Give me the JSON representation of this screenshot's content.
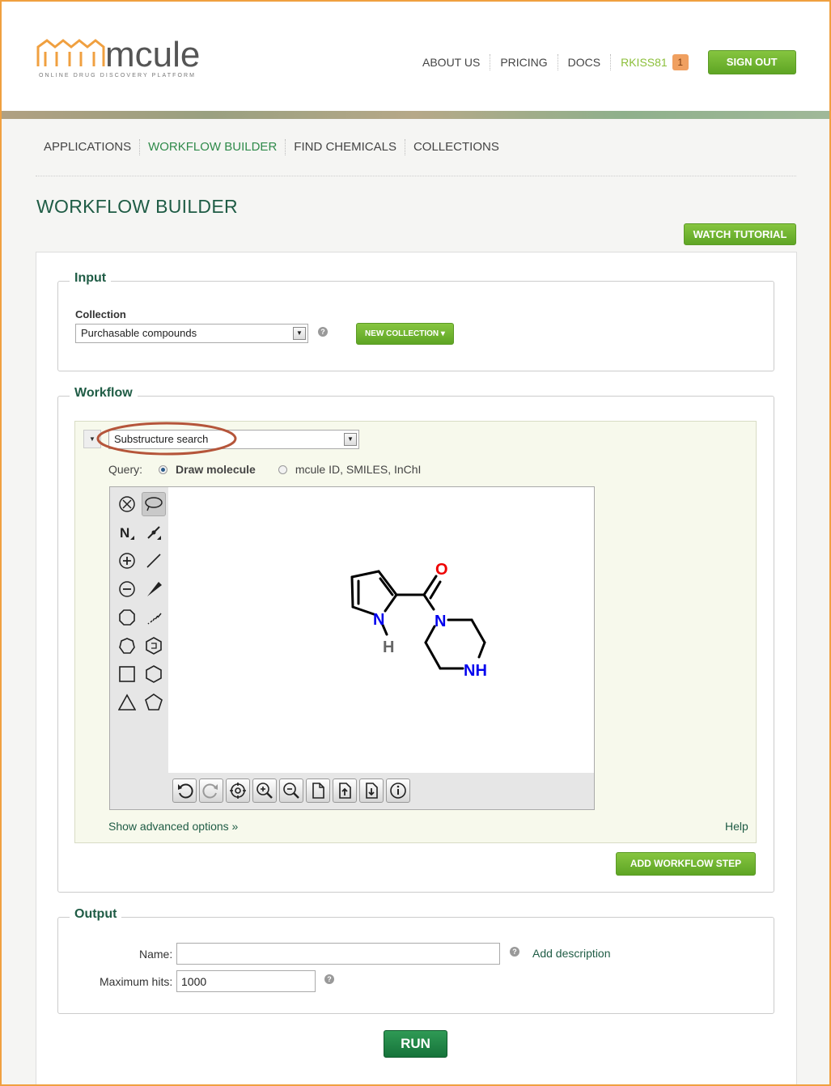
{
  "header": {
    "logo_text": "mcule",
    "logo_tagline": "ONLINE DRUG DISCOVERY PLATFORM",
    "nav": [
      "ABOUT US",
      "PRICING",
      "DOCS"
    ],
    "user": "RKISS81",
    "notifications": "1",
    "signout": "SIGN OUT"
  },
  "mainnav": {
    "items": [
      "APPLICATIONS",
      "WORKFLOW BUILDER",
      "FIND CHEMICALS",
      "COLLECTIONS"
    ],
    "active": "WORKFLOW BUILDER"
  },
  "page": {
    "title": "WORKFLOW BUILDER",
    "watch_tutorial": "WATCH TUTORIAL"
  },
  "input": {
    "legend": "Input",
    "collection_label": "Collection",
    "collection_value": "Purchasable compounds",
    "new_collection": "NEW COLLECTION ▾"
  },
  "workflow": {
    "legend": "Workflow",
    "step_value": "Substructure search",
    "query_label": "Query:",
    "query_opt_draw": "Draw molecule",
    "query_opt_id": "mcule ID, SMILES, InChI",
    "molecule_atoms": {
      "o": "O",
      "n1": "N",
      "h": "H",
      "n2": "N",
      "nh": "NH"
    },
    "show_advanced": "Show advanced options »",
    "help": "Help",
    "add_step": "ADD WORKFLOW STEP"
  },
  "output": {
    "legend": "Output",
    "name_label": "Name:",
    "name_value": "",
    "add_description": "Add description",
    "max_hits_label": "Maximum hits:",
    "max_hits_value": "1000",
    "run": "RUN"
  },
  "colors": {
    "brand_green": "#5ea524",
    "title_green": "#1f5c45",
    "nitrogen": "#0000ee",
    "oxygen": "#ee0000",
    "highlight_ring": "#b5553a"
  }
}
